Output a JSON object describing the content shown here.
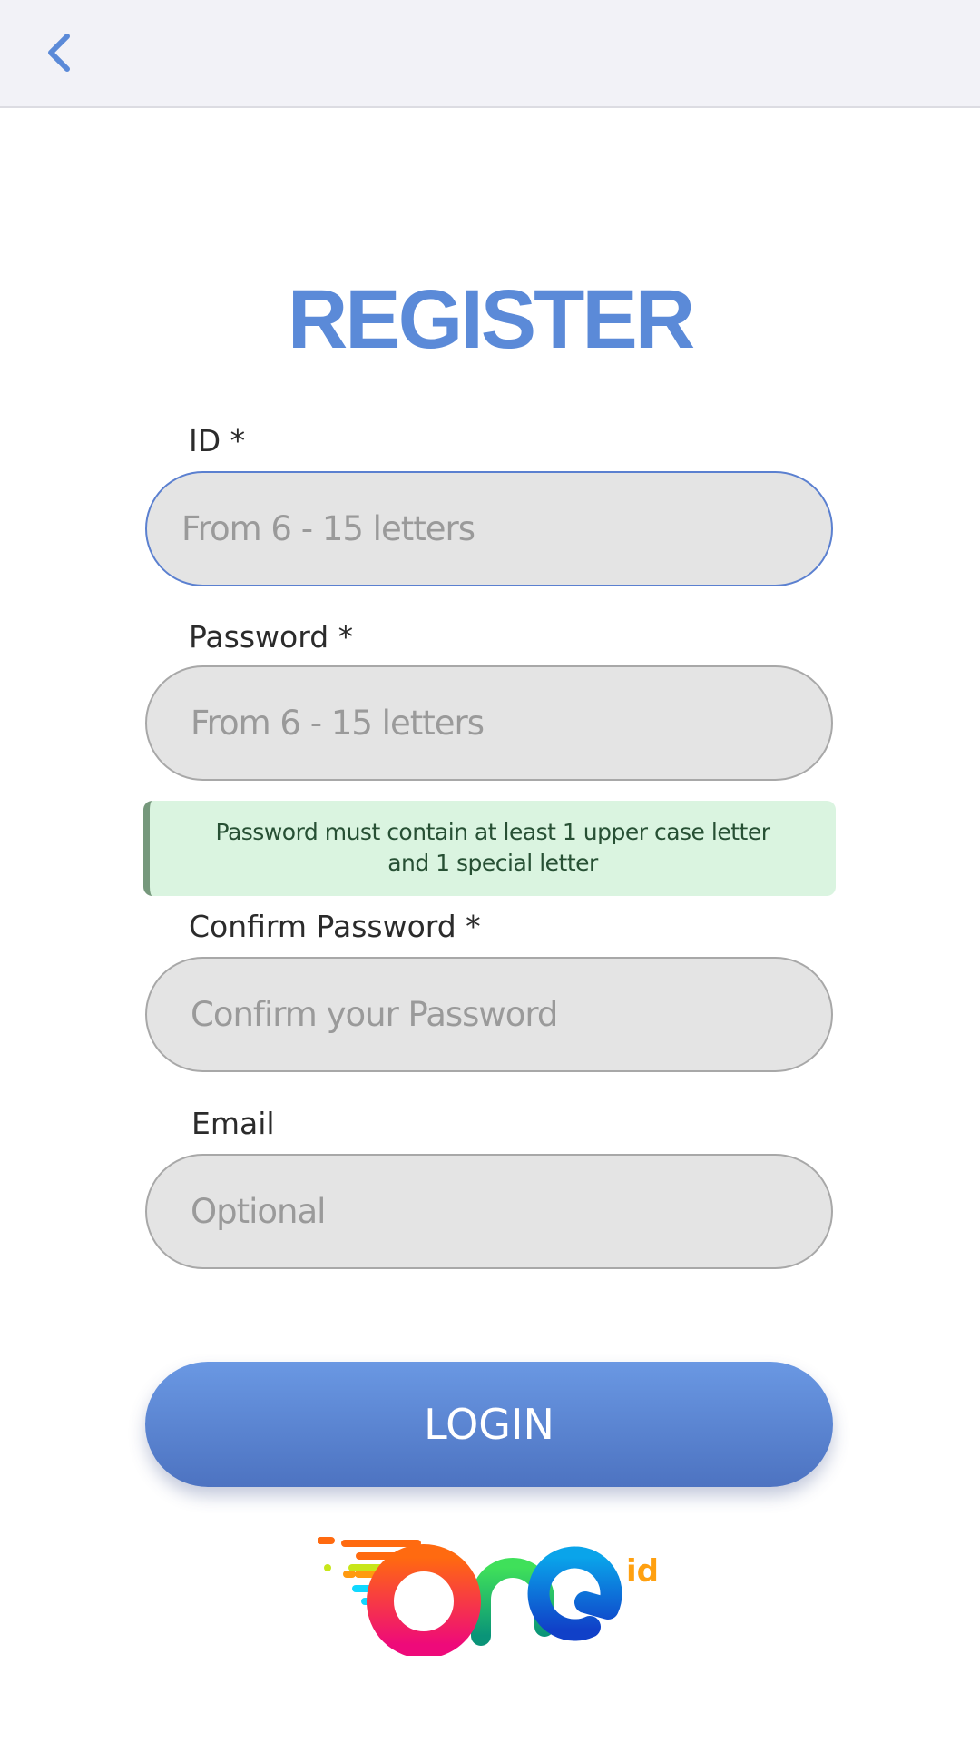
{
  "header": {
    "back_icon": "chevron-left-icon"
  },
  "title": "REGISTER",
  "form": {
    "id": {
      "label": "ID *",
      "placeholder": "From 6 - 15 letters",
      "value": ""
    },
    "password": {
      "label": "Password *",
      "placeholder": "From 6 - 15 letters",
      "value": ""
    },
    "password_hint": {
      "line1": "Password must contain at least 1 upper case letter",
      "line2": "and 1 special letter"
    },
    "confirm_password": {
      "label": "Confirm Password *",
      "placeholder": "Confirm your Password",
      "value": ""
    },
    "email": {
      "label": "Email",
      "placeholder": "Optional",
      "value": ""
    }
  },
  "submit_label": "LOGIN",
  "logo": {
    "text": "one id"
  },
  "colors": {
    "accent": "#5b8ad8",
    "hint_bg": "#daf4e0",
    "hint_text": "#275034"
  }
}
